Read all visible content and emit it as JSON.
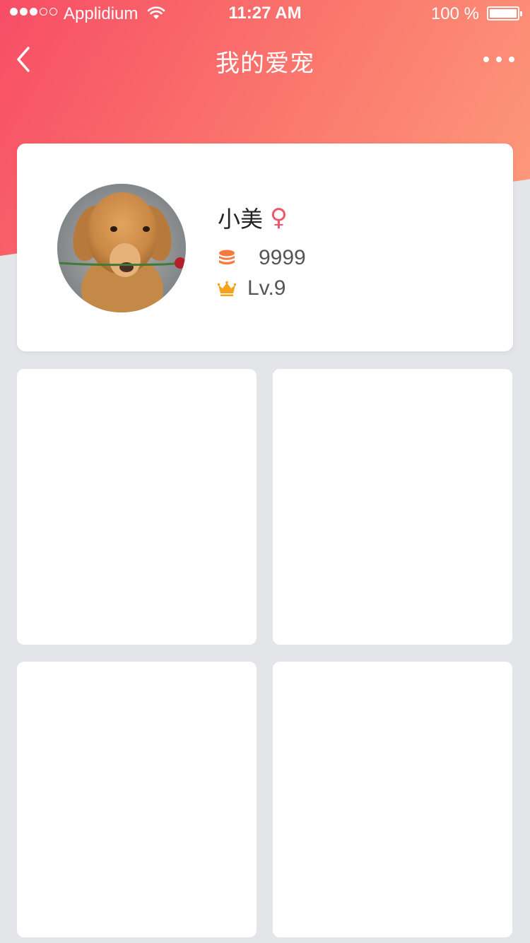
{
  "status_bar": {
    "carrier": "Applidium",
    "time": "11:27 AM",
    "battery": "100 %",
    "signal_bars_filled": 3,
    "signal_bars_total": 5
  },
  "nav": {
    "title": "我的爱宠",
    "back_icon": "chevron-left-icon",
    "more_icon": "more-horizontal-icon"
  },
  "pet": {
    "name": "小美",
    "gender_symbol": "♀",
    "coins": "9999",
    "level": "Lv.9"
  },
  "colors": {
    "gradient_start": "#f74d65",
    "gradient_end": "#fc9c7c",
    "page_bg": "#e4e5e9",
    "coin_icon": "#f57a3c",
    "crown_icon": "#f7a21b",
    "female_icon": "#f0566b"
  },
  "grid": {
    "cards": [
      {},
      {},
      {},
      {}
    ]
  }
}
